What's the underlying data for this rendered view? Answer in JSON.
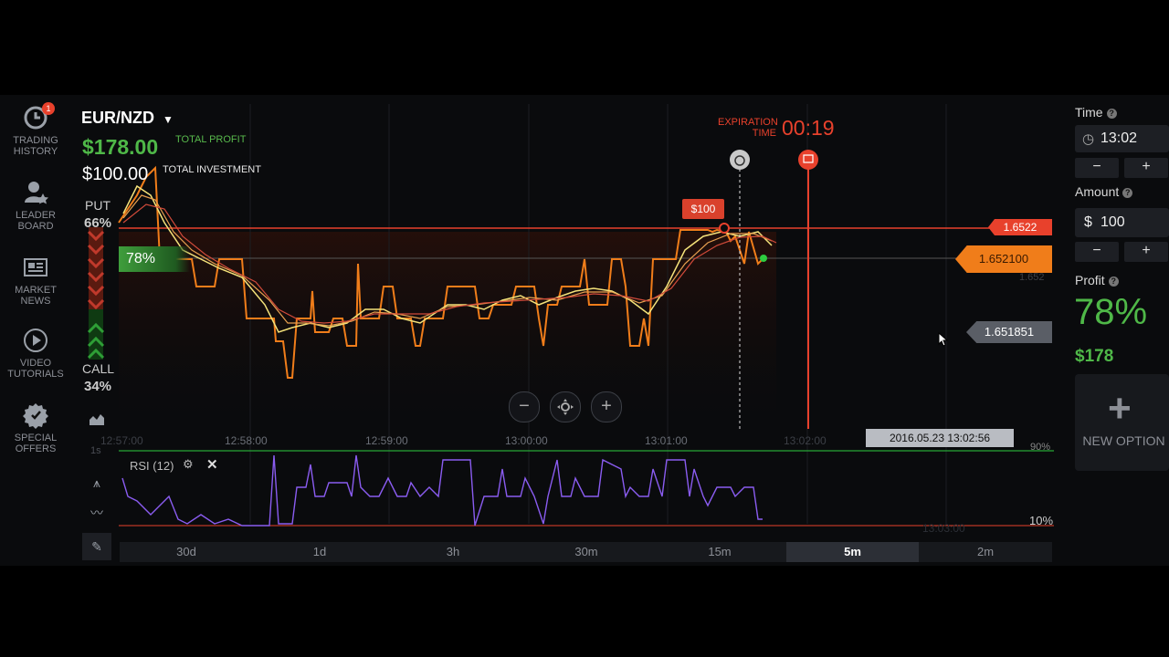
{
  "nav": [
    {
      "label": "TRADING\nHISTORY",
      "icon": "trading-history-icon",
      "badge": "1"
    },
    {
      "label": "LEADER\nBOARD",
      "icon": "leader-board-icon"
    },
    {
      "label": "MARKET\nNEWS",
      "icon": "market-news-icon"
    },
    {
      "label": "VIDEO\nTUTORIALS",
      "icon": "video-tutorials-icon"
    },
    {
      "label": "SPECIAL\nOFFERS",
      "icon": "special-offers-icon"
    }
  ],
  "asset": {
    "pair": "EUR/NZD"
  },
  "summary": {
    "total_profit": "$178.00",
    "total_profit_label": "TOTAL PROFIT",
    "total_investment": "$100.00",
    "total_investment_label": "TOTAL INVESTMENT"
  },
  "sentiment": {
    "put_label": "PUT",
    "put_pct": "66%",
    "call_label": "CALL",
    "call_pct": "34%",
    "payout": "78%"
  },
  "expiration": {
    "label_line1": "EXPIRATION",
    "label_line2": "TIME",
    "countdown": "00:19"
  },
  "chart": {
    "investment_tag": "$100",
    "price_open": "1.6522",
    "price_current": "1.652100",
    "price_faint": "1.652",
    "price_cursor": "1.651851",
    "cursor_time": "2016.05.23 13:02:56",
    "time_ticks": [
      "12:57:00",
      "12:58:00",
      "12:59:00",
      "13:00:00",
      "13:01:00",
      "13:02:00",
      "13:03:00"
    ],
    "rsi_label": "RSI (12)",
    "rsi_levels": [
      "90%",
      "10%"
    ]
  },
  "timeframes": [
    {
      "label": "30d",
      "active": false
    },
    {
      "label": "1d",
      "active": false
    },
    {
      "label": "3h",
      "active": false
    },
    {
      "label": "30m",
      "active": false
    },
    {
      "label": "15m",
      "active": false
    },
    {
      "label": "5m",
      "active": true
    },
    {
      "label": "2m",
      "active": false
    }
  ],
  "panel": {
    "time_label": "Time",
    "time_value": "13:02",
    "amount_label": "Amount",
    "amount_currency": "$",
    "amount_value": "100",
    "profit_label": "Profit",
    "profit_pct": "78%",
    "profit_value": "$178",
    "new_option_label": "NEW OPTION",
    "minus": "−",
    "plus": "+"
  },
  "colors": {
    "accent_green": "#4fb848",
    "accent_red": "#e8412c",
    "accent_orange": "#f07d1a",
    "rsi_purple": "#8a5cf0"
  }
}
